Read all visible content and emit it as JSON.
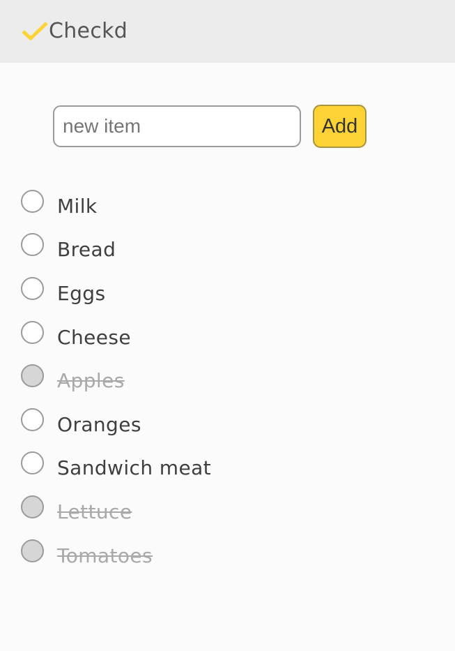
{
  "app": {
    "title": "Checkd",
    "accent": "#fdd235",
    "logo_icon": "checkmark-icon"
  },
  "form": {
    "placeholder": "new item",
    "value": "",
    "add_label": "Add"
  },
  "items": [
    {
      "label": "Milk",
      "checked": false
    },
    {
      "label": "Bread",
      "checked": false
    },
    {
      "label": "Eggs",
      "checked": false
    },
    {
      "label": "Cheese",
      "checked": false
    },
    {
      "label": "Apples",
      "checked": true
    },
    {
      "label": "Oranges",
      "checked": false
    },
    {
      "label": "Sandwich meat",
      "checked": false
    },
    {
      "label": "Lettuce",
      "checked": true
    },
    {
      "label": "Tomatoes",
      "checked": true
    }
  ]
}
